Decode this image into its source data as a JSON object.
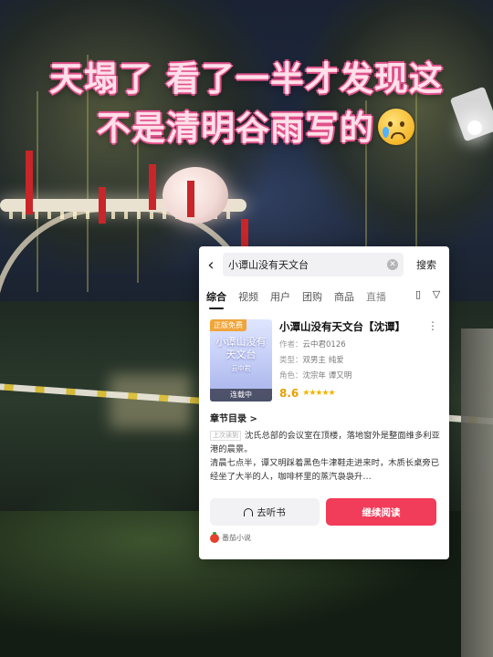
{
  "headline": {
    "line1": "天塌了 看了一半才发现这",
    "line2": "不是清明谷雨写的",
    "emoji": "crying-face-icon"
  },
  "app": {
    "search": {
      "back_icon": "chevron-left-icon",
      "query": "小谭山没有天文台",
      "clear_icon": "clear-circle-icon",
      "button": "搜索"
    },
    "tabs": [
      "综合",
      "视频",
      "用户",
      "团购",
      "商品",
      "直播"
    ],
    "active_tab": "综合",
    "tab_icons": [
      "layout-toggle-icon",
      "filter-icon"
    ],
    "book": {
      "cover_title": "小谭山没有天文台",
      "cover_author": "云中君",
      "badge": "正版免费",
      "status": "连载中",
      "title": "小潭山没有天文台【沈谭】",
      "author_label": "作者：",
      "author": "云中君0126",
      "type_label": "类型：",
      "type": "双男主  纯爱",
      "roles_label": "角色：",
      "roles": "沈宗年  谭又明",
      "score": "8.6",
      "stars": "★★★★★"
    },
    "chapter_header": "章节目录 >",
    "excerpt": {
      "last_read_tag": "上次读到",
      "para1": "沈氏总部的会议室在顶楼，落地窗外是整面维多利亚港的晨景。",
      "para2": "清晨七点半，谭又明踩着黑色牛津鞋走进来时，木质长桌旁已经坐了大半的人，咖啡杯里的蒸汽袅袅升…"
    },
    "buttons": {
      "listen": "去听书",
      "read": "继续阅读"
    },
    "source": "番茄小说"
  },
  "colors": {
    "accent": "#f13c5a",
    "headline_fill": "#ffdfe9",
    "headline_stroke": "#e0508a",
    "score": "#e6a100"
  }
}
